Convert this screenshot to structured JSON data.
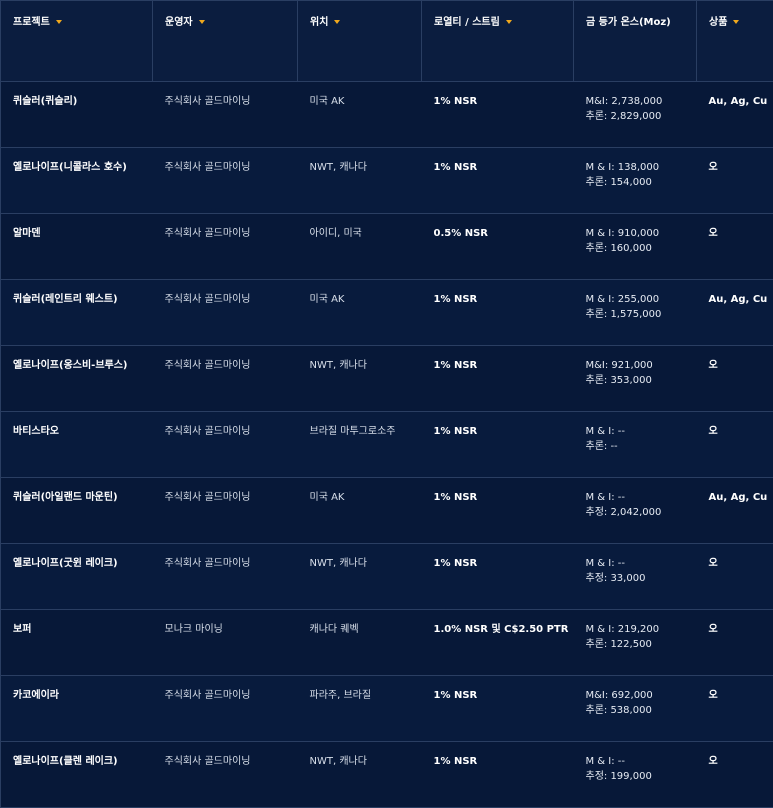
{
  "headers": [
    {
      "label": "프로젝트"
    },
    {
      "label": "운영자"
    },
    {
      "label": "위치"
    },
    {
      "label": "로열티 / 스트림"
    },
    {
      "label": "금 등가 온스(Moz)"
    },
    {
      "label": "상품"
    }
  ],
  "rows": [
    {
      "project": "퀴슬러(퀴슬리)",
      "operator": "주식회사 골드마이닝",
      "location": "미국 AK",
      "royalty": "1% NSR",
      "gold_line1": "M&I: 2,738,000",
      "gold_line2": "추론: 2,829,000",
      "commodity": "Au, Ag, Cu"
    },
    {
      "project": "옐로나이프(니콜라스 호수)",
      "operator": "주식회사 골드마이닝",
      "location": "NWT, 캐나다",
      "royalty": "1% NSR",
      "gold_line1": "M & I: 138,000",
      "gold_line2": "추론: 154,000",
      "commodity": "오"
    },
    {
      "project": "알마덴",
      "operator": "주식회사 골드마이닝",
      "location": "아이디, 미국",
      "royalty": "0.5% NSR",
      "gold_line1": "M & I: 910,000",
      "gold_line2": "추론: 160,000",
      "commodity": "오"
    },
    {
      "project": "퀴슬러(레인트리 웨스트)",
      "operator": "주식회사 골드마이닝",
      "location": "미국 AK",
      "royalty": "1% NSR",
      "gold_line1": "M & I: 255,000",
      "gold_line2": "추론: 1,575,000",
      "commodity": "Au, Ag, Cu"
    },
    {
      "project": "옐로나이프(옹스비-브루스)",
      "operator": "주식회사 골드마이닝",
      "location": "NWT, 캐나다",
      "royalty": "1% NSR",
      "gold_line1": "M&I: 921,000",
      "gold_line2": "추론: 353,000",
      "commodity": "오"
    },
    {
      "project": "바티스타오",
      "operator": "주식회사 골드마이닝",
      "location": "브라질 마투그로소주",
      "royalty": "1% NSR",
      "gold_line1": "M & I: --",
      "gold_line2": "추론: --",
      "commodity": "오"
    },
    {
      "project": "퀴슬러(아일랜드 마운틴)",
      "operator": "주식회사 골드마이닝",
      "location": "미국 AK",
      "royalty": "1% NSR",
      "gold_line1": "M & I: --",
      "gold_line2": "추정: 2,042,000",
      "commodity": "Au, Ag, Cu"
    },
    {
      "project": "옐로나이프(굿윈 레이크)",
      "operator": "주식회사 골드마이닝",
      "location": "NWT, 캐나다",
      "royalty": "1% NSR",
      "gold_line1": "M & I: --",
      "gold_line2": "추정: 33,000",
      "commodity": "오"
    },
    {
      "project": "보퍼",
      "operator": "모나크 마이닝",
      "location": "캐나다 퀘벡",
      "royalty": "1.0% NSR 및 C$2.50 PTR",
      "gold_line1": "M & I: 219,200",
      "gold_line2": "추론: 122,500",
      "commodity": "오"
    },
    {
      "project": "카코에이라",
      "operator": "주식회사 골드마이닝",
      "location": "파라주, 브라질",
      "royalty": "1% NSR",
      "gold_line1": "M&I: 692,000",
      "gold_line2": "추론: 538,000",
      "commodity": "오"
    },
    {
      "project": "옐로나이프(클렌 레이크)",
      "operator": "주식회사 골드마이닝",
      "location": "NWT, 캐나다",
      "royalty": "1% NSR",
      "gold_line1": "M & I: --",
      "gold_line2": "추정: 199,000",
      "commodity": "오"
    }
  ],
  "colors": {
    "background": "#071838",
    "border": "#2a3e62",
    "caret": "#f0a81d"
  },
  "icons": {
    "sort": "caret-down-icon"
  }
}
